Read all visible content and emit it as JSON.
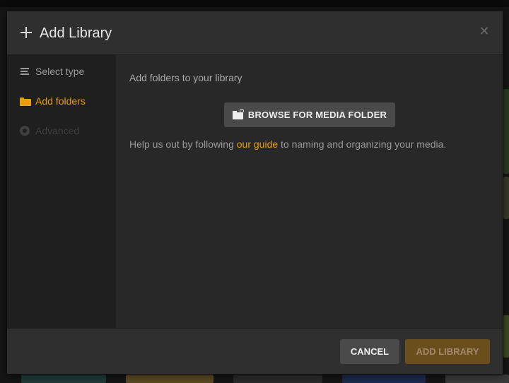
{
  "header": {
    "title": "Add Library",
    "close_glyph": "✕"
  },
  "sidebar": {
    "items": [
      {
        "label": "Select type",
        "icon": "list-icon",
        "state": "inactive"
      },
      {
        "label": "Add folders",
        "icon": "folder-icon",
        "state": "active"
      },
      {
        "label": "Advanced",
        "icon": "gear-icon",
        "state": "disabled"
      }
    ]
  },
  "content": {
    "heading": "Add folders to your library",
    "browse_label": "BROWSE FOR MEDIA FOLDER",
    "help_prefix": "Help us out by following ",
    "help_link": "our guide",
    "help_suffix": " to naming and organizing your media."
  },
  "footer": {
    "cancel_label": "CANCEL",
    "add_label": "ADD LIBRARY"
  },
  "colors": {
    "accent": "#e5a00d",
    "modal_bg": "#282828",
    "sidebar_bg": "#1f1f1f",
    "button_bg": "#4a4a4a",
    "primary_disabled_bg": "#6a4f1c"
  }
}
